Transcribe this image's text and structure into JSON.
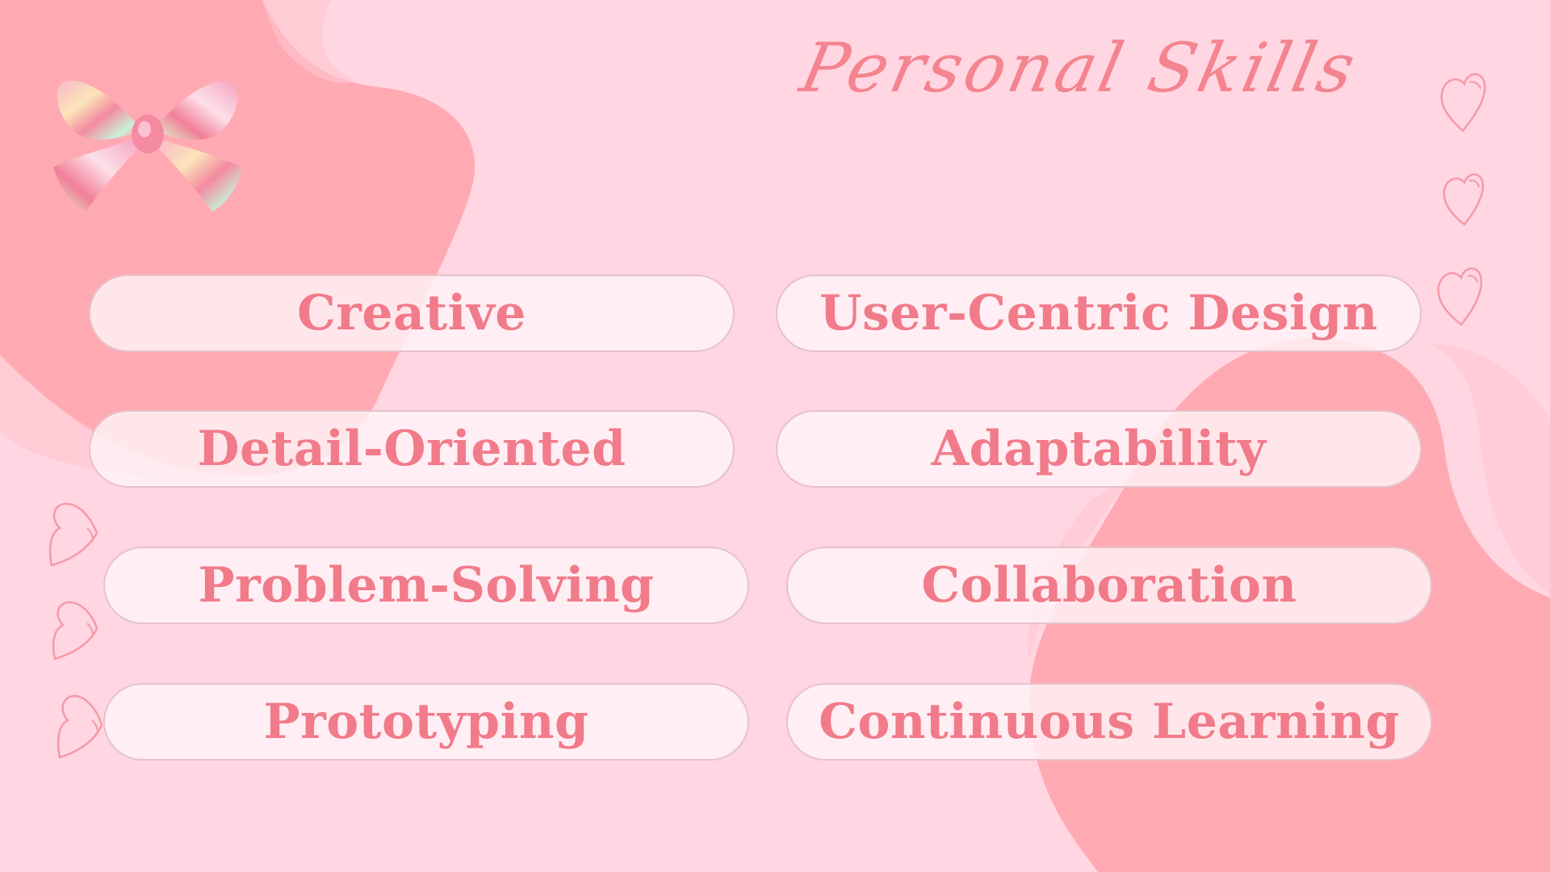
{
  "title": "Personal Skills",
  "skills": {
    "left": [
      "Creative",
      "Detail-Oriented",
      "Problem-Solving",
      "Prototyping"
    ],
    "right": [
      "User-Centric Design",
      "Adaptability",
      "Collaboration",
      "Continuous Learning"
    ]
  },
  "decorations": {
    "bow_icon": "holographic-bow",
    "heart_icon": "outline-heart"
  },
  "colors": {
    "background": "#ffd6e2",
    "blob": "#ffaab3",
    "accent_text": "#f17b8a",
    "pill_fill": "#fff3f7"
  }
}
